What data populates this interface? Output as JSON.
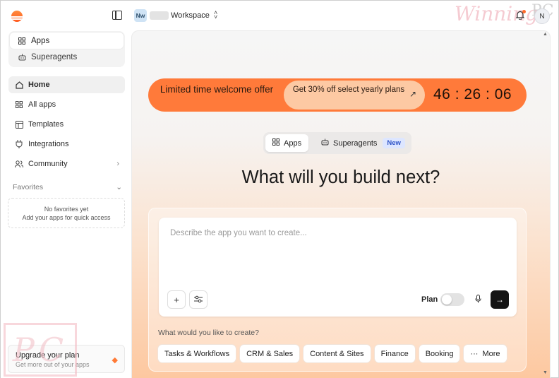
{
  "sidebar": {
    "modes": [
      {
        "label": "Apps",
        "icon": "grid-icon"
      },
      {
        "label": "Superagents",
        "icon": "bot-icon"
      }
    ],
    "nav": [
      {
        "label": "Home",
        "icon": "home-icon"
      },
      {
        "label": "All apps",
        "icon": "grid-icon"
      },
      {
        "label": "Templates",
        "icon": "template-icon"
      },
      {
        "label": "Integrations",
        "icon": "plug-icon"
      },
      {
        "label": "Community",
        "icon": "users-icon"
      }
    ],
    "favorites_title": "Favorites",
    "favorites_empty_title": "No favorites yet",
    "favorites_empty_hint": "Add your apps for quick access",
    "upgrade_title": "Upgrade your plan",
    "upgrade_subtitle": "Get more out of your apps"
  },
  "topbar": {
    "workspace_initials": "Nw",
    "workspace_name": "Workspace",
    "user_initial": "N"
  },
  "watermarks": {
    "corner_logo": "PC",
    "top_text": "Winning",
    "top_pc": "PC"
  },
  "banner": {
    "left_text": "Limited time welcome offer",
    "cta_text": "Get 30% off select yearly plans",
    "countdown": "46 : 26 : 06"
  },
  "mode_toggle": {
    "apps_label": "Apps",
    "superagents_label": "Superagents",
    "new_badge": "New"
  },
  "headline": "What will you build next?",
  "composer": {
    "placeholder": "Describe the app you want to create...",
    "plan_label": "Plan"
  },
  "suggestions": {
    "prompt": "What would you like to create?",
    "chips": [
      "Tasks & Workflows",
      "CRM & Sales",
      "Content & Sites",
      "Finance",
      "Booking",
      "More"
    ]
  },
  "colors": {
    "accent": "#ff7a3a",
    "banner_cta_bg": "#fdc9a3",
    "new_badge_bg": "#dde6ff",
    "new_badge_text": "#2f54c7"
  }
}
